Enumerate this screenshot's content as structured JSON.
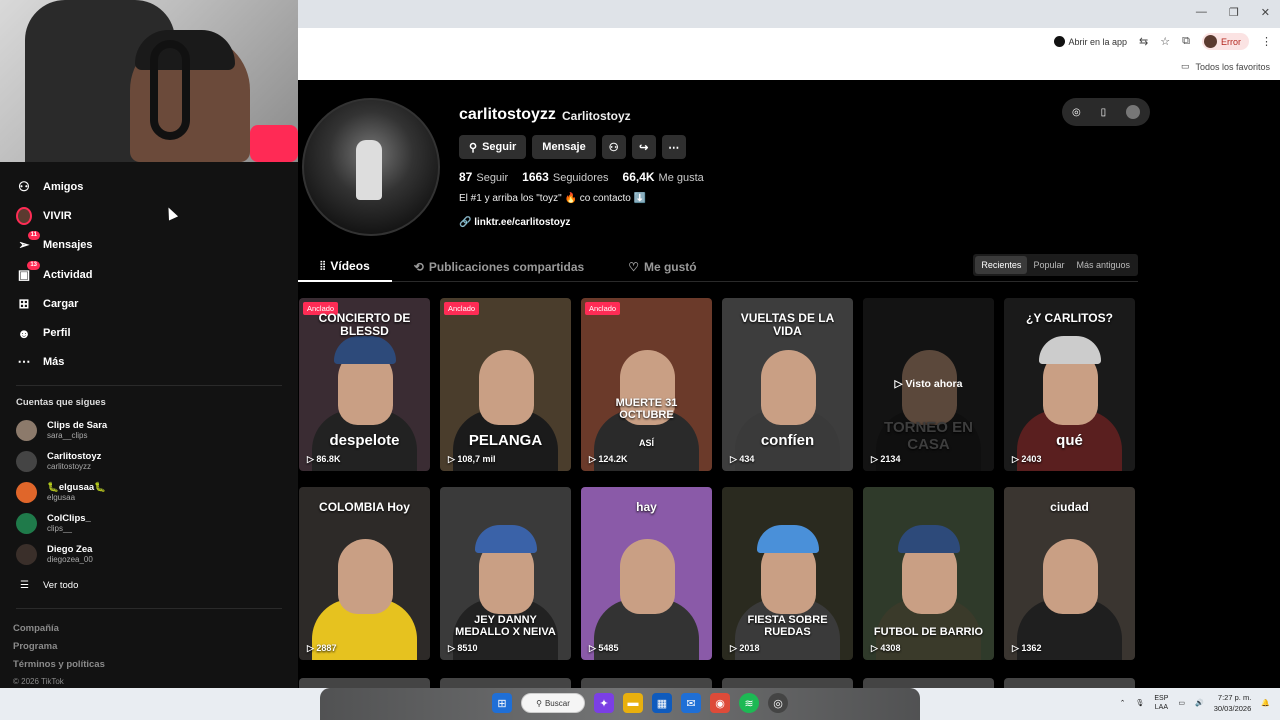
{
  "browser": {
    "open_app_label": "Abrir en la app",
    "profile_status": "Error",
    "bookmarks_label": "Todos los favoritos",
    "window_controls": [
      "—",
      "❐",
      "✕"
    ]
  },
  "sidebar": {
    "nav": [
      {
        "label": "Amigos",
        "icon": "friends-icon",
        "badge": ""
      },
      {
        "label": "VIVIR",
        "icon": "live-avatar-icon",
        "badge": ""
      },
      {
        "label": "Mensajes",
        "icon": "messages-icon",
        "badge": "11"
      },
      {
        "label": "Actividad",
        "icon": "activity-icon",
        "badge": "13"
      },
      {
        "label": "Cargar",
        "icon": "upload-icon",
        "badge": ""
      },
      {
        "label": "Perfil",
        "icon": "profile-icon",
        "badge": ""
      },
      {
        "label": "Más",
        "icon": "more-icon",
        "badge": ""
      }
    ],
    "following_title": "Cuentas que sigues",
    "following": [
      {
        "name": "Clips de Sara",
        "username": "sara__clips",
        "color": "#8c7a6b"
      },
      {
        "name": "Carlitostoyz",
        "username": "carlitostoyzz",
        "color": "#444444"
      },
      {
        "name": "🐛elgusaa🐛",
        "username": "elgusaa",
        "color": "#e0662a"
      },
      {
        "name": "ColClips_",
        "username": "clips__",
        "color": "#1f7a4a"
      },
      {
        "name": "Diego Zea",
        "username": "diegozea_00",
        "color": "#3a2f2a"
      }
    ],
    "see_all": "Ver todo",
    "footer": [
      "Compañía",
      "Programa",
      "Términos y políticas"
    ],
    "copyright": "© 2026 TikTok"
  },
  "profile": {
    "username": "carlitostoyzz",
    "nickname": "Carlitostoyz",
    "follow_label": "Seguir",
    "message_label": "Mensaje",
    "following_count": "87",
    "following_label": "Seguir",
    "followers_count": "1663",
    "followers_label": "Seguidores",
    "likes_count": "66,4K",
    "likes_label": "Me gusta",
    "bio": "El #1 y arriba los \"toyz\" 🔥 co contacto ⬇️",
    "link": "linktr.ee/carlitostoyz"
  },
  "tabs": [
    {
      "label": "Vídeos",
      "icon": "grid-icon",
      "active": true
    },
    {
      "label": "Publicaciones compartidas",
      "icon": "repost-icon",
      "active": false
    },
    {
      "label": "Me gustó",
      "icon": "heart-icon",
      "active": false
    }
  ],
  "sort_options": [
    {
      "label": "Recientes",
      "active": true
    },
    {
      "label": "Popular",
      "active": false
    },
    {
      "label": "Más antiguos",
      "active": false
    }
  ],
  "videos": [
    {
      "pinned": "Anclado",
      "top": "CONCIERTO DE BLESSD",
      "bottom": "despelote",
      "views": "86.8K",
      "bg": "#3a2c33",
      "cap": "#2d4a7a",
      "shirt": "#222"
    },
    {
      "pinned": "Anclado",
      "top": "",
      "bottom": "PELANGA",
      "views": "108,7 mil",
      "bg": "#4a3d2c",
      "cap": "",
      "shirt": "#1b1b1b"
    },
    {
      "pinned": "Anclado",
      "top": "",
      "bottom": "MUERTE 31 OCTUBRE",
      "views": "124.2K",
      "bg": "#6b3a2a",
      "cap": "",
      "shirt": "#2a2a2a",
      "sub": "ASÍ"
    },
    {
      "pinned": "",
      "top": "VUELTAS DE LA VIDA",
      "bottom": "confíen",
      "views": "434",
      "bg": "#3d3d3d",
      "cap": "",
      "shirt": "#3a3a3a"
    },
    {
      "pinned": "",
      "top": "",
      "bottom": "TORNEO EN CASA",
      "views": "2134",
      "bg": "#2a2a2a",
      "cap": "",
      "shirt": "#222",
      "watched": "▷ Visto ahora"
    },
    {
      "pinned": "",
      "top": "¿Y CARLITOS?",
      "bottom": "qué",
      "views": "2403",
      "bg": "#1a1a1a",
      "cap": "#cccccc",
      "shirt": "#5a1f1f"
    },
    {
      "pinned": "",
      "top": "COLOMBIA Hoy",
      "bottom": "",
      "views": "2887",
      "bg": "#2d2a28",
      "cap": "",
      "shirt": "#e6c21f"
    },
    {
      "pinned": "",
      "top": "",
      "bottom": "JEY DANNY MEDALLO X NEIVA",
      "views": "8510",
      "bg": "#3a3a3a",
      "cap": "#3a62a8",
      "shirt": "#222"
    },
    {
      "pinned": "",
      "top": "hay",
      "bottom": "",
      "views": "5485",
      "bg": "#8a5aa8",
      "cap": "",
      "shirt": "#333"
    },
    {
      "pinned": "",
      "top": "",
      "bottom": "FIESTA SOBRE RUEDAS",
      "views": "2018",
      "bg": "#2a2a1f",
      "cap": "#4a90d9",
      "shirt": "#3a3a3a"
    },
    {
      "pinned": "",
      "top": "",
      "bottom": "FUTBOL DE BARRIO",
      "views": "4308",
      "bg": "#2f3a2a",
      "cap": "#2d4a7a",
      "shirt": "#3a3a2a"
    },
    {
      "pinned": "",
      "top": "ciudad",
      "bottom": "",
      "views": "1362",
      "bg": "#3a3530",
      "cap": "",
      "shirt": "#1f1f1f"
    }
  ],
  "taskbar": {
    "search_label": "Buscar",
    "lang": "ESP",
    "region": "LAA",
    "time": "7:27 p. m.",
    "date": "30/03/2026"
  }
}
